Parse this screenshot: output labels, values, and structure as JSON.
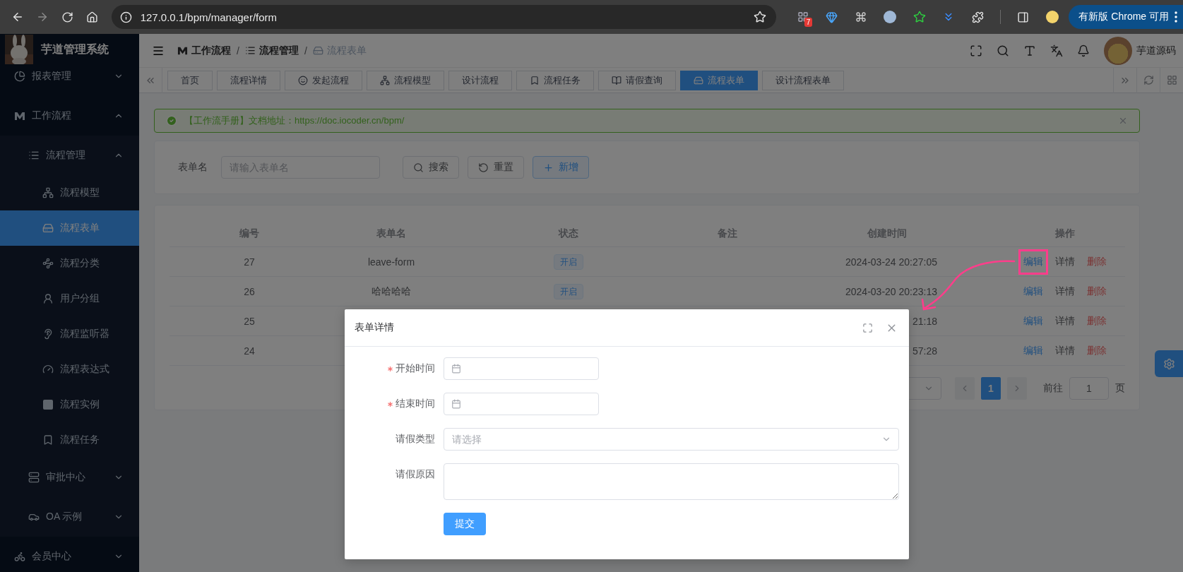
{
  "browser": {
    "url": "127.0.0.1/bpm/manager/form",
    "forward_disabled": true,
    "extension_badge": "7",
    "update_button": "有新版 Chrome 可用"
  },
  "sidebar": {
    "title": "芋道管理系统",
    "items": [
      {
        "label": "报表管理",
        "expanded": false
      },
      {
        "label": "工作流程",
        "expanded": true,
        "children": [
          {
            "label": "流程管理",
            "expanded": true,
            "children": [
              {
                "label": "流程模型",
                "selected": false
              },
              {
                "label": "流程表单",
                "selected": true
              },
              {
                "label": "流程分类",
                "selected": false
              },
              {
                "label": "用户分组",
                "selected": false
              },
              {
                "label": "流程监听器",
                "selected": false
              },
              {
                "label": "流程表达式",
                "selected": false
              },
              {
                "label": "流程实例",
                "selected": false
              },
              {
                "label": "流程任务",
                "selected": false
              }
            ]
          },
          {
            "label": "审批中心",
            "expanded": false
          },
          {
            "label": "OA 示例",
            "expanded": false
          }
        ]
      },
      {
        "label": "会员中心",
        "expanded": false
      }
    ]
  },
  "header": {
    "breadcrumb": [
      {
        "label": "工作流程"
      },
      {
        "separator": "/",
        "label": "流程管理"
      },
      {
        "separator": "/",
        "label": "流程表单"
      }
    ],
    "user": "芋道源码"
  },
  "tabs": [
    {
      "label": "首页",
      "selected": false
    },
    {
      "label": "流程详情",
      "selected": false
    },
    {
      "label": "发起流程",
      "selected": false
    },
    {
      "label": "流程模型",
      "selected": false
    },
    {
      "label": "设计流程",
      "selected": false
    },
    {
      "label": "流程任务",
      "selected": false
    },
    {
      "label": "请假查询",
      "selected": false
    },
    {
      "label": "流程表单",
      "selected": true
    },
    {
      "label": "设计流程表单",
      "selected": false
    }
  ],
  "alert": {
    "text": "【工作流手册】文档地址：https://doc.iocoder.cn/bpm/"
  },
  "search": {
    "label": "表单名",
    "placeholder": "请输入表单名",
    "buttons": [
      {
        "kind": "search",
        "label": "搜索"
      },
      {
        "kind": "reset",
        "label": "重置"
      },
      {
        "kind": "add",
        "label": "新增"
      }
    ]
  },
  "table": {
    "columns": [
      "编号",
      "表单名",
      "状态",
      "备注",
      "创建时间",
      "操作"
    ],
    "rows": [
      {
        "id": "27",
        "name": "leave-form",
        "status": "开启",
        "created": "2024-03-24 20:27:05",
        "highlighted": true,
        "actions": [
          {
            "kind": "edit",
            "label": "编辑"
          },
          {
            "kind": "detail",
            "label": "详情"
          },
          {
            "kind": "delete",
            "label": "删除"
          }
        ]
      },
      {
        "id": "26",
        "name": "哈哈哈哈",
        "status": "开启",
        "created": "2024-03-20 20:23:13",
        "highlighted": false,
        "actions": [
          {
            "kind": "edit",
            "label": "编辑"
          },
          {
            "kind": "detail",
            "label": "详情"
          },
          {
            "kind": "delete",
            "label": "删除"
          }
        ]
      },
      {
        "id": "25",
        "created": "21:18",
        "highlighted": false,
        "actions": [
          {
            "kind": "edit",
            "label": "编辑"
          },
          {
            "kind": "detail",
            "label": "详情"
          },
          {
            "kind": "delete",
            "label": "删除"
          }
        ]
      },
      {
        "id": "24",
        "created": "57:28",
        "highlighted": false,
        "actions": [
          {
            "kind": "edit",
            "label": "编辑"
          },
          {
            "kind": "detail",
            "label": "详情"
          },
          {
            "kind": "delete",
            "label": "删除"
          }
        ]
      }
    ]
  },
  "pagination": {
    "pages": [
      {
        "label": "1",
        "selected": true
      }
    ],
    "goto_label": "前往",
    "goto_value": "1",
    "page_suffix": "页"
  },
  "dialog": {
    "title": "表单详情",
    "fields": [
      {
        "kind": "date",
        "label": "开始时间",
        "required": true
      },
      {
        "kind": "date",
        "label": "结束时间",
        "required": true
      },
      {
        "kind": "select",
        "label": "请假类型",
        "placeholder": "请选择",
        "required": false
      },
      {
        "kind": "textarea",
        "label": "请假原因",
        "required": false
      }
    ],
    "submit": "提交"
  }
}
